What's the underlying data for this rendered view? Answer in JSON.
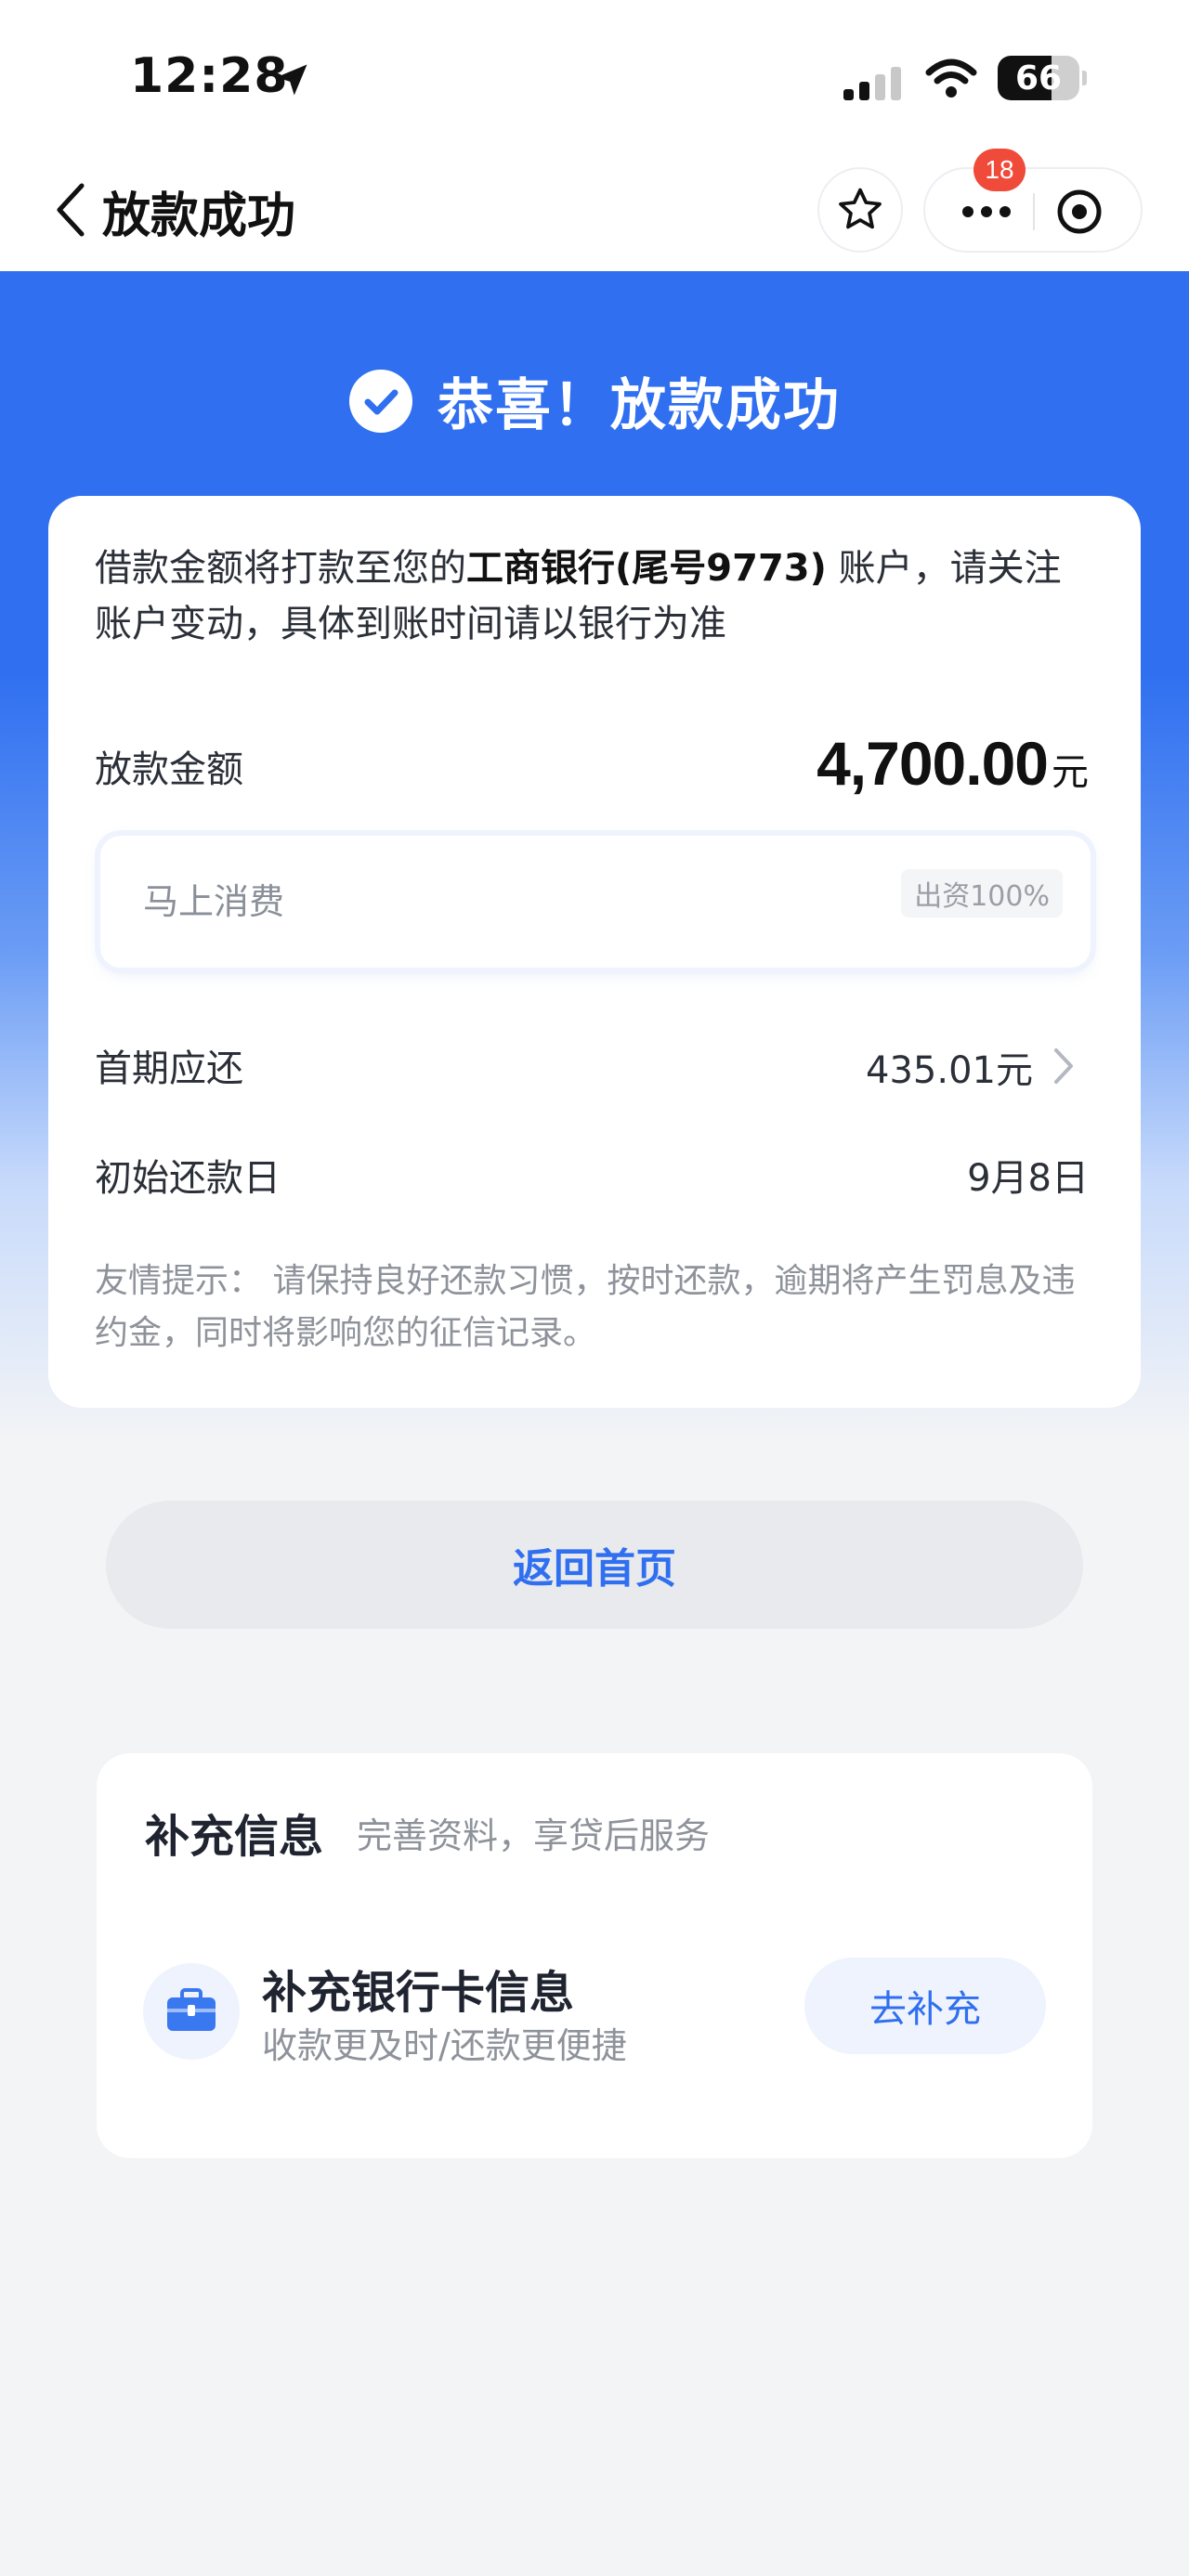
{
  "status_bar": {
    "time": "12:28",
    "battery": "66",
    "battery_level": 0.66
  },
  "nav": {
    "title": "放款成功",
    "badge_count": "18"
  },
  "hero": {
    "title": "恭喜！放款成功"
  },
  "card": {
    "notice_prefix": "借款金额将打款至您的",
    "notice_bank": "工商银行(尾号9773)",
    "notice_suffix": " 账户，请关注账户变动，具体到账时间请以银行为准",
    "loan_label": "放款金额",
    "loan_amount": "4,700.00",
    "loan_unit": "元",
    "lender_name": "马上消费",
    "lender_share": "出资100%",
    "first_repay_label": "首期应还",
    "first_repay_value": "435.01元",
    "start_date_label": "初始还款日",
    "start_date_value": "9月8日",
    "tip_label": "友情提示：",
    "tip_text": " 请保持良好还款习惯，按时还款，逾期将产生罚息及违约金，同时将影响您的征信记录。"
  },
  "home_button": "返回首页",
  "supplement": {
    "title": "补充信息",
    "subtitle": "完善资料，享贷后服务",
    "item_title": "补充银行卡信息",
    "item_desc": "收款更及时/还款更便捷",
    "button": "去补充"
  },
  "colors": {
    "primary": "#2f6ff0",
    "badge": "#f04a3a"
  }
}
